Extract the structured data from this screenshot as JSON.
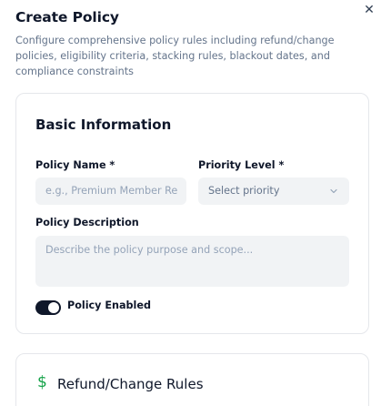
{
  "dialog": {
    "title": "Create Policy",
    "description": "Configure comprehensive policy rules including refund/change policies, eligibility criteria, stacking rules, blackout dates, and compliance constraints",
    "close_icon": "close-icon"
  },
  "basic_info": {
    "heading": "Basic Information",
    "policy_name": {
      "label": "Policy Name *",
      "placeholder": "e.g., Premium Member Re"
    },
    "priority": {
      "label": "Priority Level *",
      "selected": "Select priority",
      "icon": "chevron-down-icon"
    },
    "description": {
      "label": "Policy Description",
      "placeholder": "Describe the policy purpose and scope..."
    },
    "enabled": {
      "label": "Policy Enabled",
      "on": true
    }
  },
  "refund_rules": {
    "heading": "Refund/Change Rules",
    "icon": "dollar-icon",
    "icon_color": "#16a34a"
  }
}
